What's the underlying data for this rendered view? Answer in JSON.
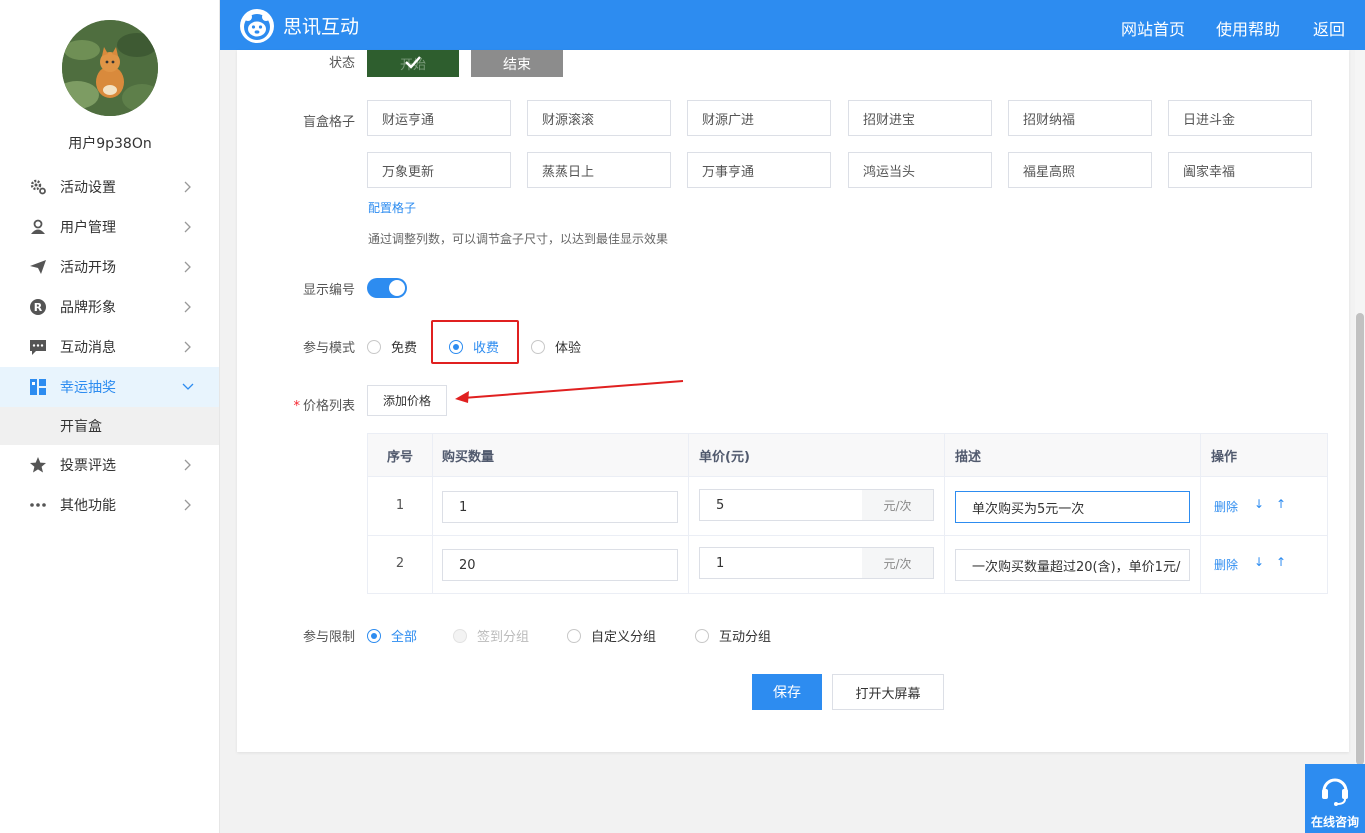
{
  "sidebar": {
    "username": "用户9p38On",
    "items": [
      {
        "label": "活动设置",
        "icon": "gear-icon"
      },
      {
        "label": "用户管理",
        "icon": "user-icon"
      },
      {
        "label": "活动开场",
        "icon": "paper-plane-icon"
      },
      {
        "label": "品牌形象",
        "icon": "registered-icon"
      },
      {
        "label": "互动消息",
        "icon": "message-icon"
      },
      {
        "label": "幸运抽奖",
        "icon": "lottery-icon",
        "active": true
      },
      {
        "label": "投票评选",
        "icon": "star-icon"
      },
      {
        "label": "其他功能",
        "icon": "more-icon"
      }
    ],
    "sub_item": "开盲盒"
  },
  "header": {
    "brand": "思讯互动",
    "nav": [
      "网站首页",
      "使用帮助",
      "返回"
    ]
  },
  "form": {
    "status_label": "状态",
    "status_start": "开始",
    "status_end": "结束",
    "grid_label": "盲盒格子",
    "grid_cells": [
      "财运亨通",
      "财源滚滚",
      "财源广进",
      "招财进宝",
      "招财纳福",
      "日进斗金",
      "万象更新",
      "蒸蒸日上",
      "万事亨通",
      "鸿运当头",
      "福星高照",
      "阖家幸福"
    ],
    "config_link": "配置格子",
    "hint": "通过调整列数，可以调节盒子尺寸，以达到最佳显示效果",
    "show_number_label": "显示编号",
    "show_number_on": true,
    "mode_label": "参与模式",
    "mode_options": [
      "免费",
      "收费",
      "体验"
    ],
    "mode_selected": "收费",
    "price_label": "价格列表",
    "add_price": "添加价格",
    "table": {
      "headers": [
        "序号",
        "购买数量",
        "单价(元)",
        "描述",
        "操作"
      ],
      "rows": [
        {
          "index": "1",
          "qty": "1",
          "price": "5",
          "unit": "元/次",
          "desc": "单次购买为5元一次",
          "delete": "删除"
        },
        {
          "index": "2",
          "qty": "20",
          "price": "1",
          "unit": "元/次",
          "desc": "一次购买数量超过20(含)，单价1元/",
          "delete": "删除"
        }
      ]
    },
    "limit_label": "参与限制",
    "limit_options": [
      "全部",
      "签到分组",
      "自定义分组",
      "互动分组"
    ],
    "limit_selected": "全部",
    "save": "保存",
    "open_screen": "打开大屏幕"
  },
  "consult": "在线咨询",
  "colors": {
    "primary": "#2d8cf0",
    "start_btn": "#2e5e2e",
    "end_btn": "#8c8c8c",
    "highlight": "#e02020"
  }
}
